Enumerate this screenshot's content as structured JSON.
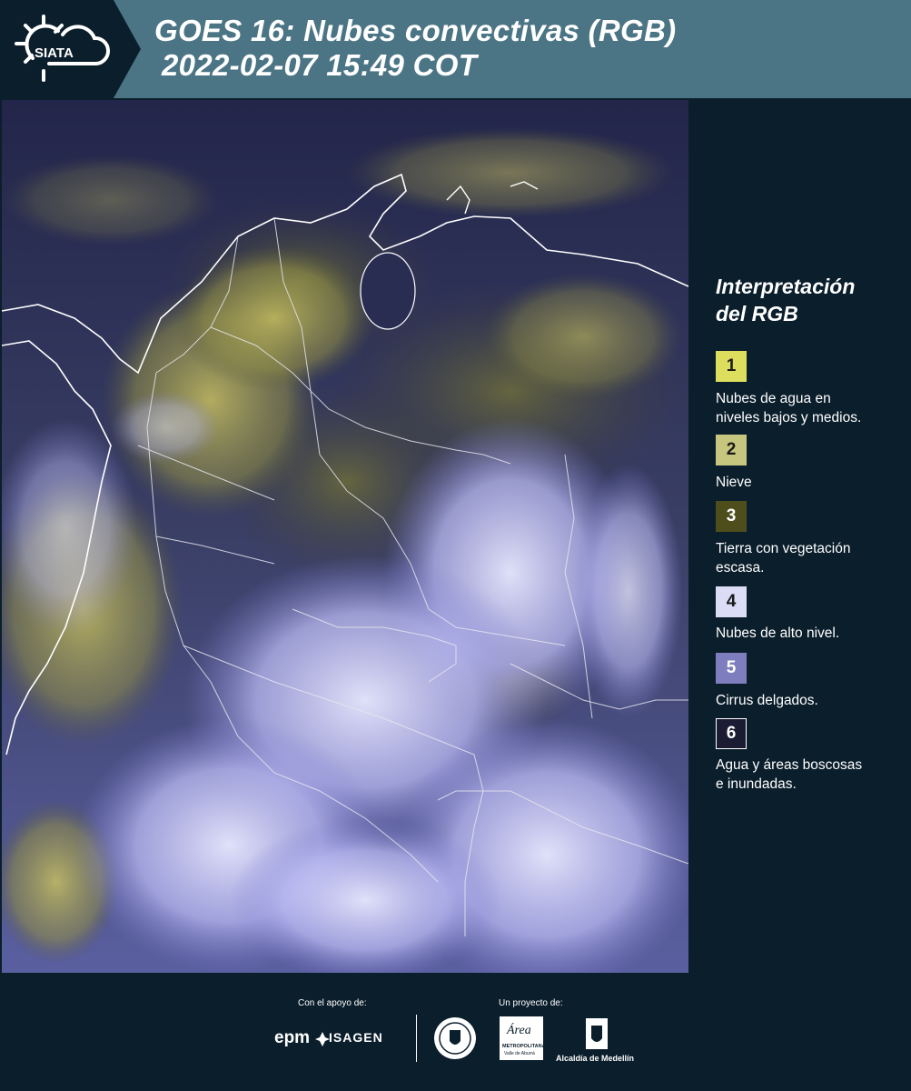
{
  "header": {
    "logo_text": "SIATA",
    "title_line1": "GOES 16: Nubes convectivas (RGB)",
    "title_line2": "2022-02-07 15:49 COT"
  },
  "legend": {
    "title_line1": "Interpretación",
    "title_line2": "del RGB",
    "items": [
      {
        "number": "1",
        "color": "#dede5e",
        "label_line1": "Nubes de agua en",
        "label_line2": "niveles bajos y medios."
      },
      {
        "number": "2",
        "color": "#c6c67e",
        "label_line1": "Nieve",
        "label_line2": ""
      },
      {
        "number": "3",
        "color": "#4e4e1d",
        "label_line1": "Tierra con vegetación",
        "label_line2": "escasa."
      },
      {
        "number": "4",
        "color": "#dcdcf6",
        "label_line1": "Nubes de alto nivel.",
        "label_line2": ""
      },
      {
        "number": "5",
        "color": "#7e7ebe",
        "label_line1": "Cirrus delgados.",
        "label_line2": ""
      },
      {
        "number": "6",
        "color": "#1b1b33",
        "label_line1": "Agua y áreas boscosas",
        "label_line2": "e inundadas."
      }
    ]
  },
  "footer": {
    "support_label": "Con el apoyo de:",
    "project_label": "Un proyecto de:",
    "epm": "epm",
    "isagen": "ISAGEN",
    "area_metropolitana": "Área",
    "area_metropolitana_sub": "METROPOLITANA",
    "area_metropolitana_sub2": "Valle de Aburrá",
    "alcaldia": "Alcaldía de Medellín"
  }
}
